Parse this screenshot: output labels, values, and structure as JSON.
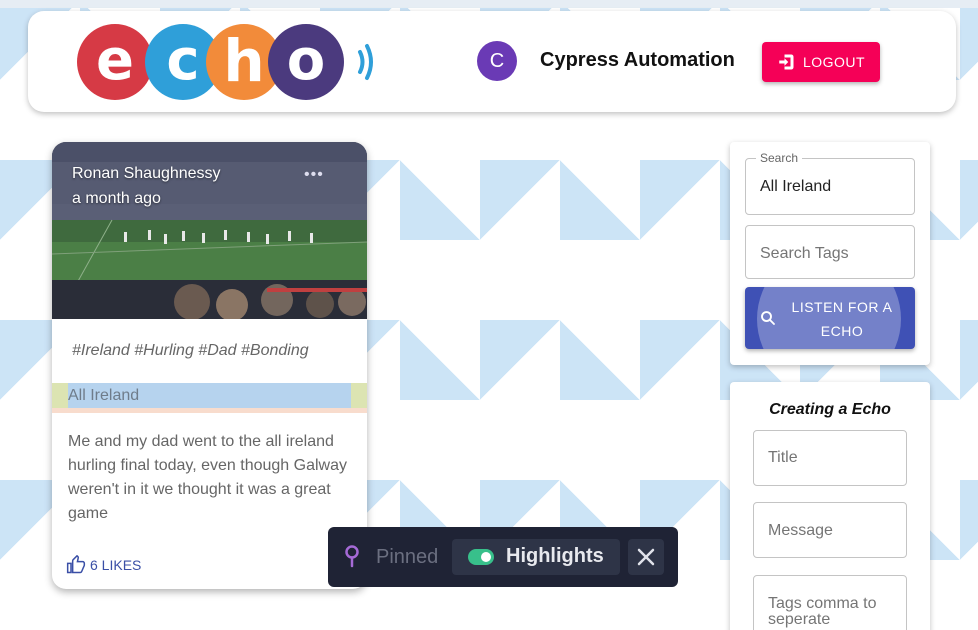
{
  "header": {
    "logo_text": "echo",
    "avatar_initial": "C",
    "username": "Cypress Automation",
    "logout_label": "LOGOUT"
  },
  "card": {
    "author": "Ronan Shaughnessy",
    "time_ago": "a month ago",
    "tags": "#Ireland #Hurling #Dad #Bonding",
    "category": "All Ireland",
    "body": "Me and my dad went to the all ireland hurling final today, even though Galway weren't in it we thought it was a great game",
    "likes_label": "6 LIKES"
  },
  "search_panel": {
    "search_label": "Search",
    "search_value": "All Ireland",
    "tags_placeholder": "Search Tags",
    "listen_button_label": "LISTEN FOR A ECHO"
  },
  "create_panel": {
    "title": "Creating a Echo",
    "title_placeholder": "Title",
    "message_placeholder": "Message",
    "tags_placeholder": "Tags comma to seperate"
  },
  "toolbar": {
    "pinned_label": "Pinned",
    "highlights_label": "Highlights",
    "highlights_on": true
  },
  "colors": {
    "logout": "#f50057",
    "listen": "#3f51b5",
    "avatar": "#6a3ab5",
    "toolbar": "#1f2335"
  }
}
